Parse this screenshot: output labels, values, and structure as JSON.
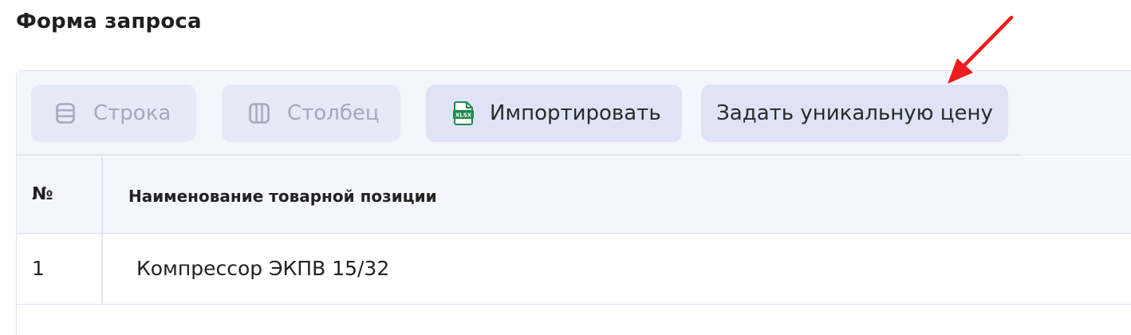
{
  "page": {
    "title": "Форма запроса"
  },
  "toolbar": {
    "row_label": "Строка",
    "row_icon": "rows-icon",
    "column_label": "Столбец",
    "column_icon": "columns-icon",
    "import_label": "Импортировать",
    "import_icon": "xlsx-file-icon",
    "import_icon_text": "XLSX",
    "unique_price_label": "Задать уникальную цену"
  },
  "table": {
    "headers": [
      "№",
      "Наименование товарной позиции"
    ],
    "rows": [
      {
        "num": "1",
        "name": "Компрессор ЭКПВ 15/32"
      }
    ]
  },
  "colors": {
    "accent_button": "#dfe3f6",
    "disabled_button": "#e6e9f6",
    "header_bg": "#f4f6fc",
    "arrow": "#ee1c1c",
    "xlsx_green": "#1e8a4c"
  }
}
